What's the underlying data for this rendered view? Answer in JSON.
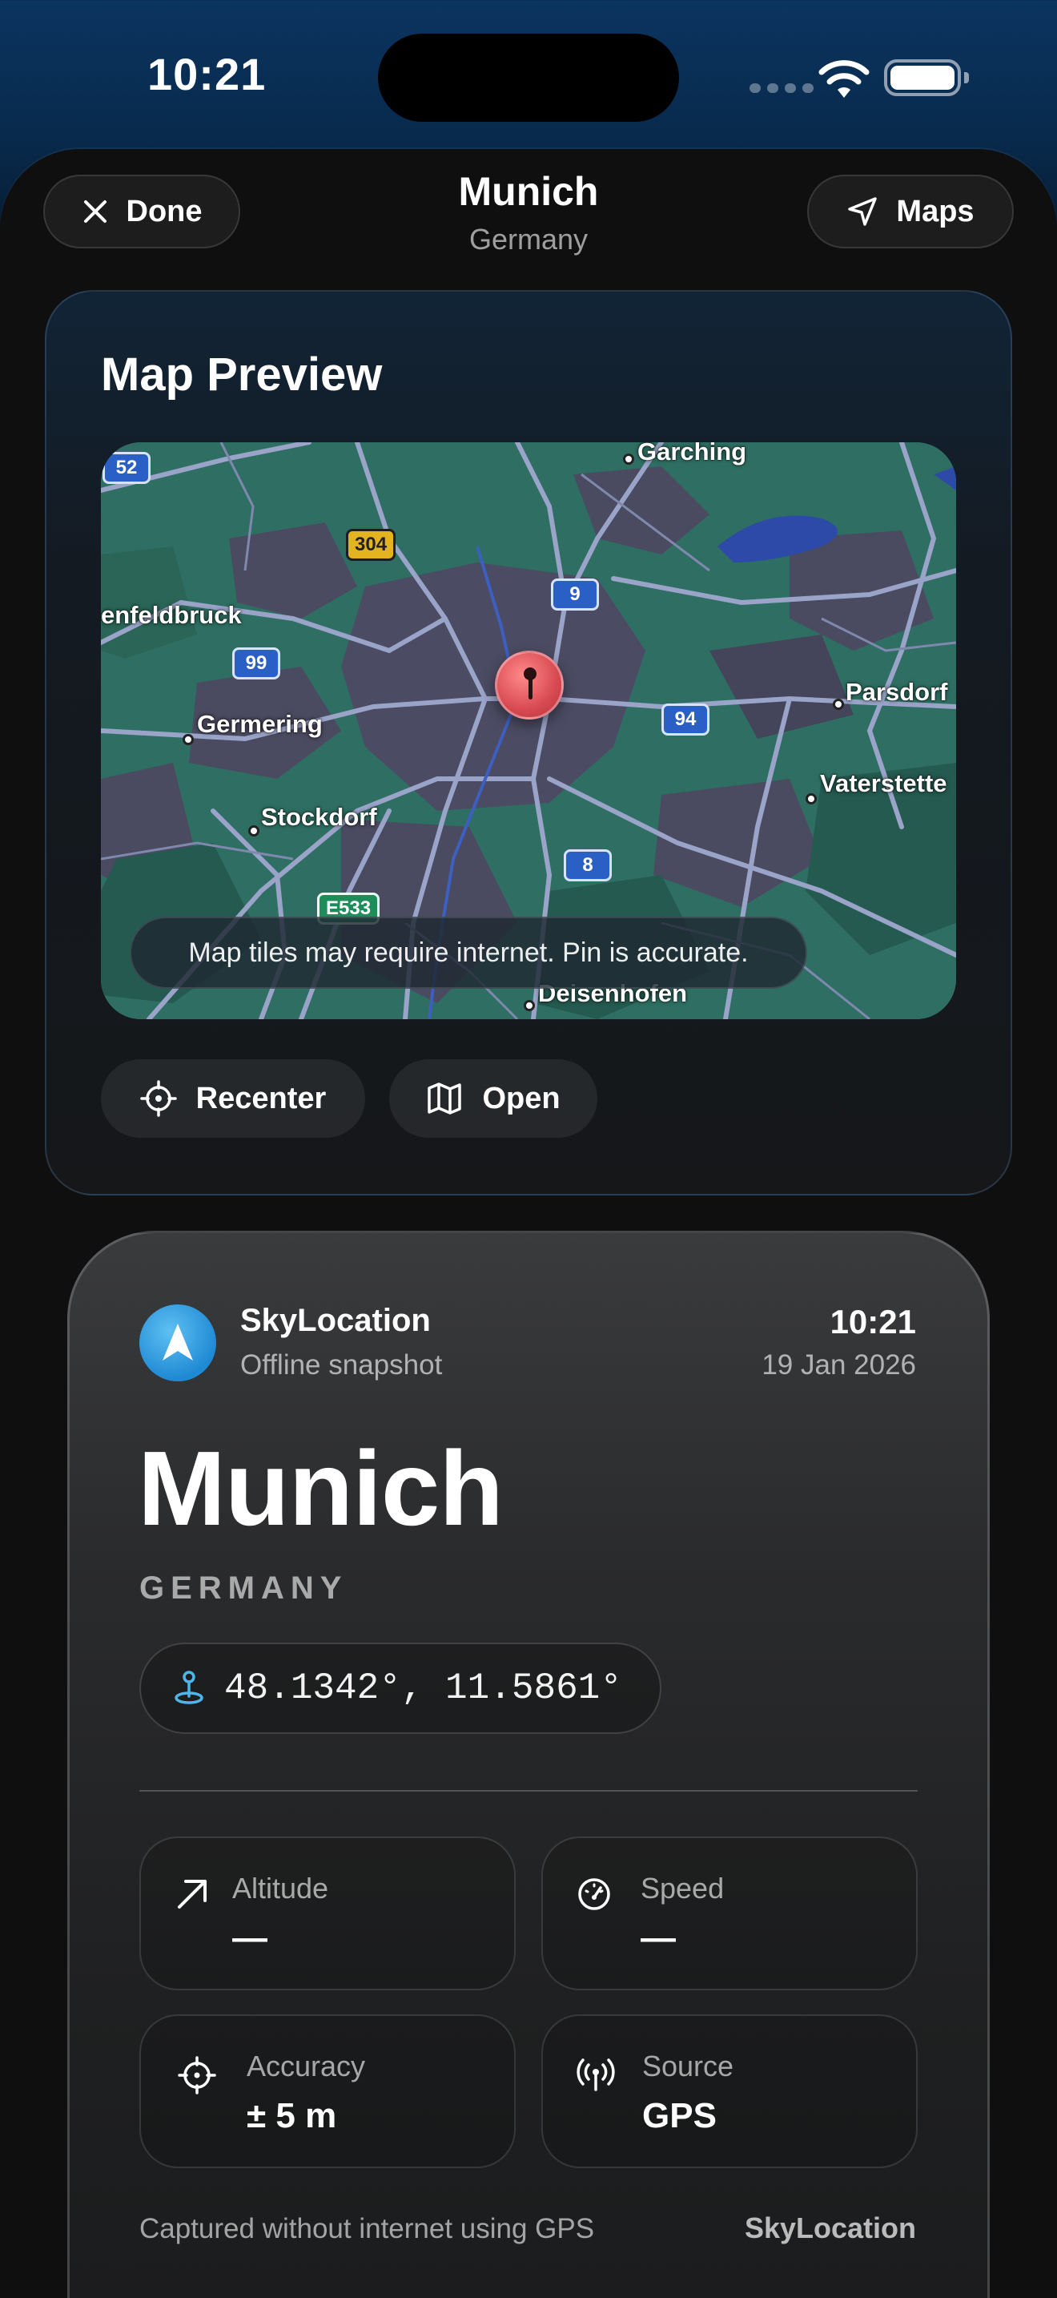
{
  "status_bar": {
    "time": "10:21"
  },
  "nav": {
    "done_label": "Done",
    "title": "Munich",
    "subtitle": "Germany",
    "maps_label": "Maps"
  },
  "map_card": {
    "title": "Map Preview",
    "places": [
      {
        "name": "Garching"
      },
      {
        "name": "enfeldbruck"
      },
      {
        "name": "Germering"
      },
      {
        "name": "Stockdorf"
      },
      {
        "name": "Parsdorf"
      },
      {
        "name": "Vaterstette"
      },
      {
        "name": "Deisenhofen"
      }
    ],
    "road_shields": [
      "52",
      "304",
      "9",
      "99",
      "94",
      "8",
      "E533"
    ],
    "toast": "Map tiles may require internet. Pin is accurate.",
    "recenter_label": "Recenter",
    "open_label": "Open"
  },
  "snapshot": {
    "app_name": "SkyLocation",
    "app_subtitle": "Offline snapshot",
    "time": "10:21",
    "date": "19 Jan 2026",
    "city": "Munich",
    "country": "GERMANY",
    "coordinates": "48.1342°, 11.5861°",
    "stats": {
      "altitude": {
        "label": "Altitude",
        "value": "—"
      },
      "speed": {
        "label": "Speed",
        "value": "—"
      },
      "accuracy": {
        "label": "Accuracy",
        "value": "± 5 m"
      },
      "source": {
        "label": "Source",
        "value": "GPS"
      }
    },
    "footer_text": "Captured without internet using GPS",
    "footer_brand": "SkyLocation"
  },
  "colors": {
    "accent_blue": "#1f8ad4",
    "pin_red": "#d84a52",
    "map_green": "#2f6f63"
  }
}
